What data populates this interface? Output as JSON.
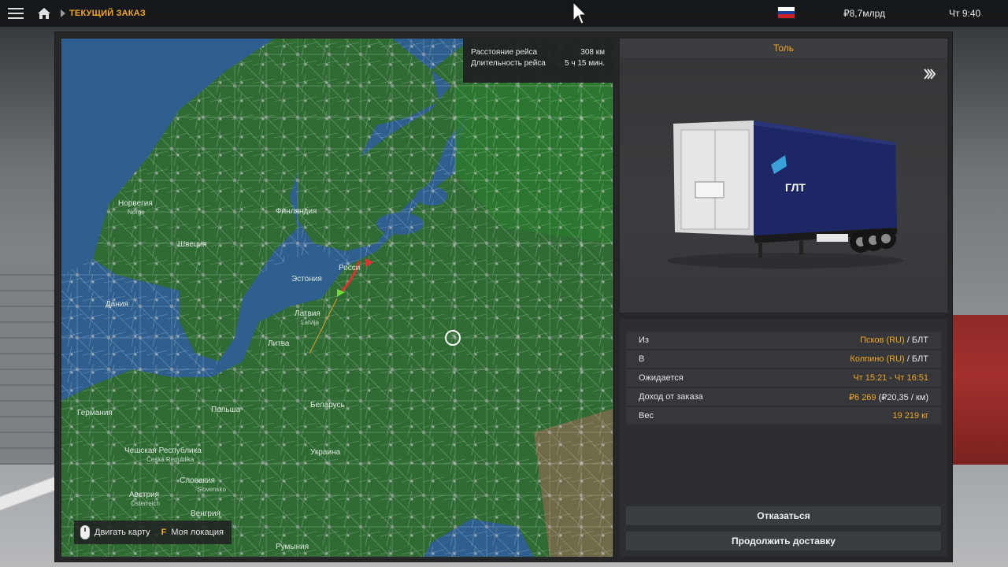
{
  "header": {
    "breadcrumb": "ТЕКУЩИЙ ЗАКАЗ",
    "money": "₽8,7млрд",
    "clock": "Чт 9:40",
    "flag_colors": [
      "#ffffff",
      "#1c3f9e",
      "#d0202a"
    ]
  },
  "map": {
    "route_info": {
      "distance_label": "Расстояние рейса",
      "distance_value": "308 км",
      "duration_label": "Длительность рейса",
      "duration_value": "5 ч 15 мин."
    },
    "labels": {
      "norway": "Норвегия",
      "norway_local": "Norge",
      "sweden": "Швеция",
      "finland": "Финляндия",
      "estonia": "Эстония",
      "latvia": "Латвия",
      "latvia_local": "Latvija",
      "lithuania": "Литва",
      "denmark": "Дания",
      "belarus": "Беларусь",
      "ukraine": "Украина",
      "poland": "Польша",
      "germany": "Германия",
      "czech": "Чешская Республика",
      "czech_local": "Česká Republika",
      "slovakia": "Словакия",
      "slovakia_local": "Slovensko",
      "austria": "Австрия",
      "austria_local": "Österreich",
      "hungary": "Венгрия",
      "romania": "Румыния",
      "russia_partial": "Росси"
    },
    "hint": {
      "move_map": "Двигать карту",
      "key": "F",
      "my_location": "Моя локация"
    },
    "colors": {
      "sea": "#2f5f8f",
      "land": "#2f6b33",
      "route": "#e03030",
      "roads": "#e8e8e8"
    }
  },
  "cargo": {
    "name": "Толь",
    "trailer_brand": "ГЛТ"
  },
  "details": {
    "rows": [
      {
        "label": "Из",
        "value_hl": "Псков (RU)",
        "value_rest": " / БЛТ"
      },
      {
        "label": "В",
        "value_hl": "Колпино (RU)",
        "value_rest": " / БЛТ"
      },
      {
        "label": "Ожидается",
        "value_hl": "Чт 15:21 - Чт 16:51",
        "value_rest": ""
      },
      {
        "label": "Доход от заказа",
        "value_hl": "₽6 269",
        "value_rest": " (₽20,35 / км)"
      },
      {
        "label": "Вес",
        "value_hl": "19 219 кг",
        "value_rest": ""
      }
    ]
  },
  "actions": {
    "decline": "Отказаться",
    "continue": "Продолжить доставку"
  },
  "accent_color": "#f2a623"
}
